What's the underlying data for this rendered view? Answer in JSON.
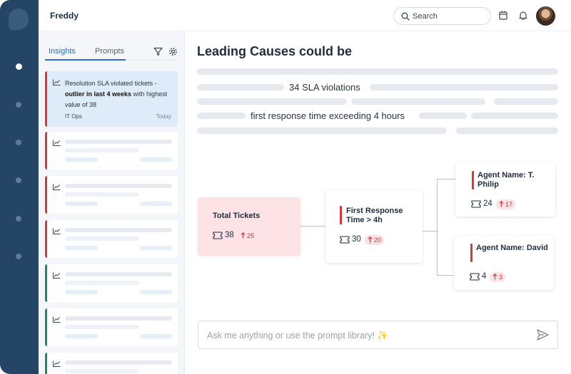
{
  "app": {
    "title": "Freddy"
  },
  "search": {
    "placeholder": "Search"
  },
  "tabs": [
    {
      "label": "Insights"
    },
    {
      "label": "Prompts"
    }
  ],
  "insight_card": {
    "text_lead": "Resolution SLA violated tickets - ",
    "text_bold": "outlier in last 4 weeks",
    "text_tail": " with highest value of 38",
    "group": "IT Ops",
    "date": "Today"
  },
  "main": {
    "heading": "Leading Causes could be",
    "line1": "34 SLA violations",
    "line2": "first response time exceeding 4 hours"
  },
  "tree": {
    "root": {
      "title": "Total Tickets",
      "count": "38",
      "delta": "25"
    },
    "mid": {
      "title": "First Response Time > 4h",
      "count": "30",
      "delta": "20"
    },
    "leaf1": {
      "title": "Agent Name: T. Philip",
      "count": "24",
      "delta": "17"
    },
    "leaf2": {
      "title": "Agent Name: David",
      "count": "4",
      "delta": "3"
    }
  },
  "ask": {
    "placeholder": "Ask me anything or use the prompt library! ✨"
  },
  "colors": {
    "rail": "#244565",
    "accent_blue": "#2a6fcc",
    "alert_red": "#d9373c",
    "ok_green": "#1e8c5a",
    "root_node_bg": "#fde3e6"
  },
  "icons": [
    "search-icon",
    "calendar-icon",
    "bell-icon",
    "filter-icon",
    "gear-icon",
    "trend-chart-icon",
    "ticket-icon",
    "arrow-up-icon",
    "send-icon"
  ]
}
